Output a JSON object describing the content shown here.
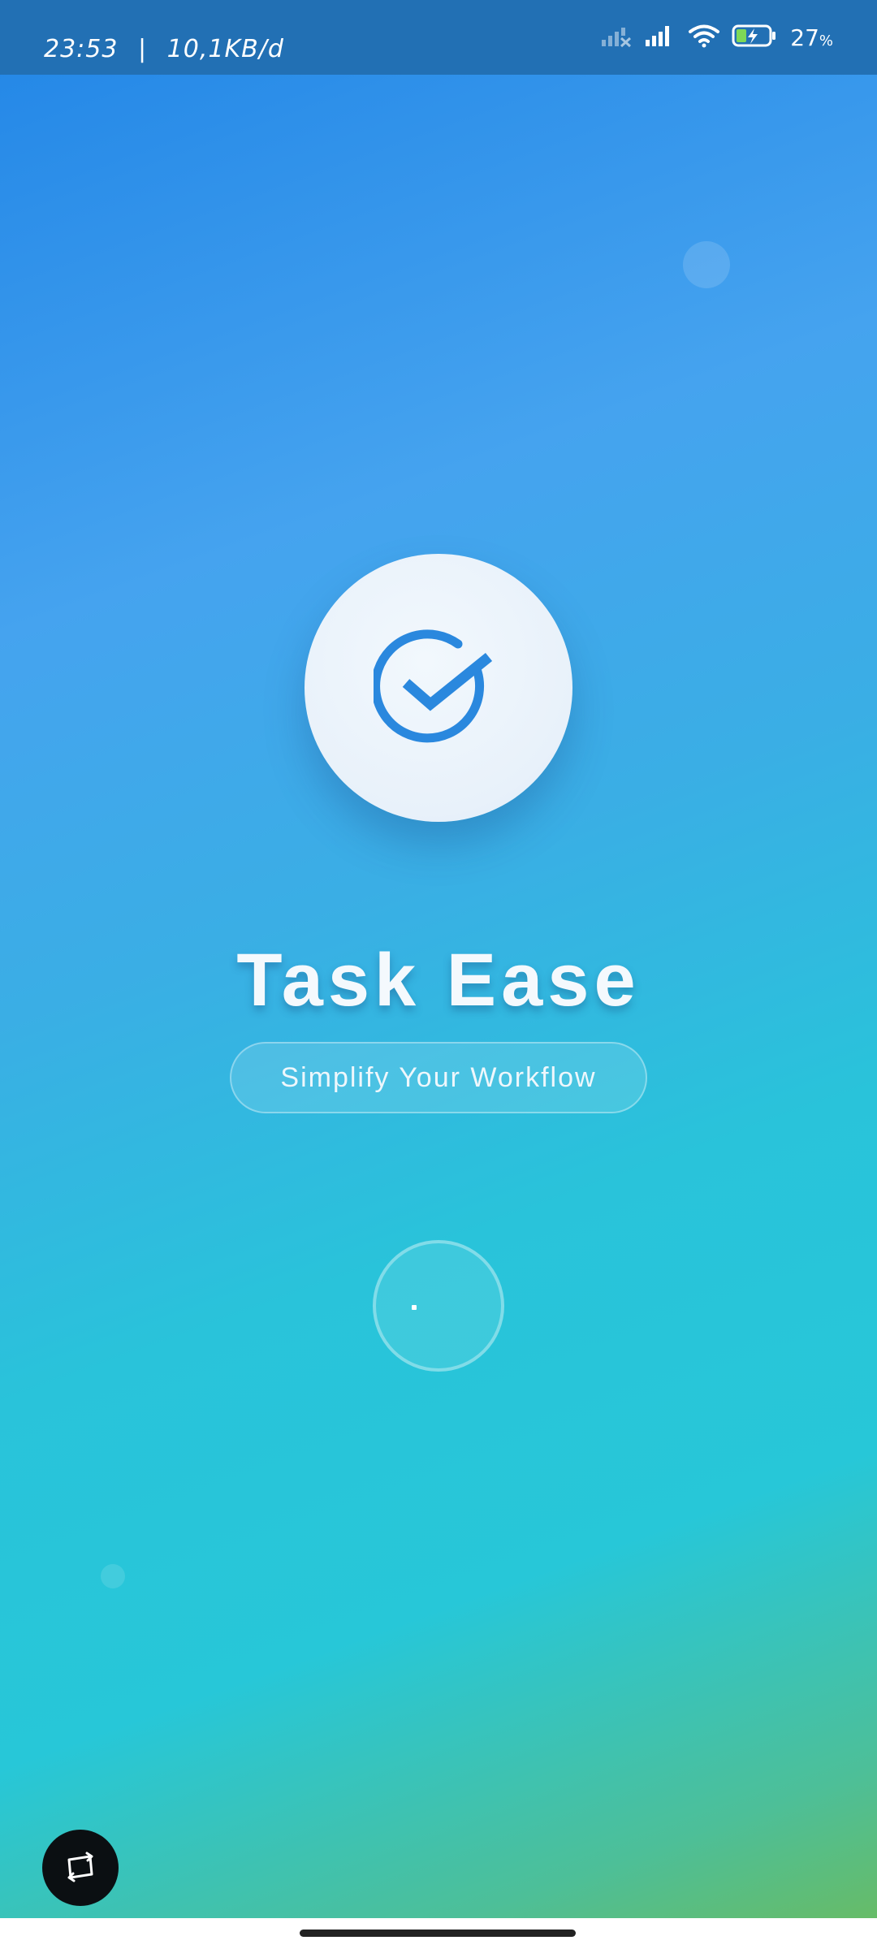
{
  "status_bar": {
    "time": "23:53",
    "separator": "|",
    "data_speed": "10,1KB/d",
    "battery_percent": "27",
    "battery_symbol": "%",
    "icons": [
      "no-signal-icon",
      "cellular-signal-icon",
      "wifi-icon",
      "battery-charging-icon"
    ]
  },
  "app": {
    "title": "Task Ease",
    "tagline": "Simplify Your Workflow",
    "logo_icon": "check-circle-icon",
    "loading_icon": "loading-spinner-icon"
  },
  "floating_button": {
    "icon": "screen-rotate-icon"
  },
  "colors": {
    "gradient_top": "#2185e6",
    "gradient_middle": "#27c7d8",
    "gradient_bottom": "#6cbb5e",
    "status_bar": "#2270b4",
    "logo_accent": "#2a88de"
  }
}
